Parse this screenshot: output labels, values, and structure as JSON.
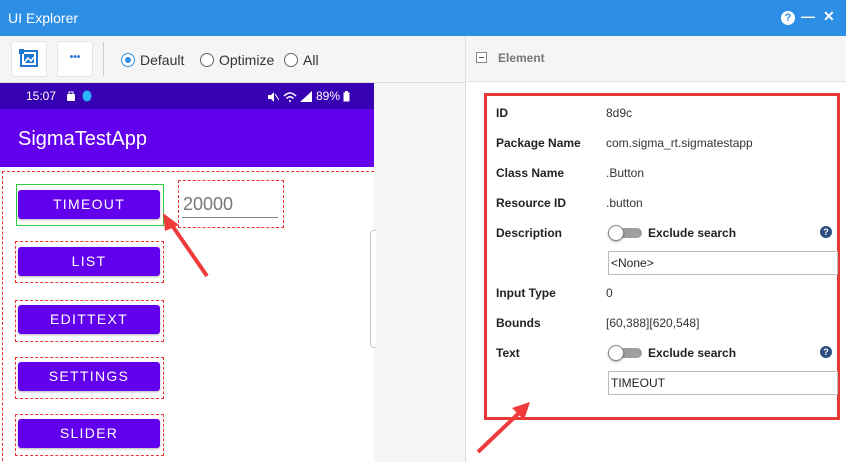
{
  "window": {
    "title": "UI Explorer",
    "help_glyph": "?",
    "minimize_glyph": "—",
    "close_glyph": "✕"
  },
  "toolbar": {
    "more_glyph": "•••",
    "modes": [
      {
        "label": "Default",
        "selected": true
      },
      {
        "label": "Optimize",
        "selected": false
      },
      {
        "label": "All",
        "selected": false
      }
    ]
  },
  "device": {
    "status_time": "15:07",
    "status_battery": "89%",
    "app_title": "SigmaTestApp",
    "buttons": [
      "TIMEOUT",
      "LIST",
      "EDITTEXT",
      "SETTINGS",
      "SLIDER"
    ],
    "edit_value": "20000"
  },
  "element_panel": {
    "header": "Element",
    "rows": [
      {
        "key": "ID",
        "value": "8d9c"
      },
      {
        "key": "Package Name",
        "value": "com.sigma_rt.sigmatestapp"
      },
      {
        "key": "Class Name",
        "value": ".Button"
      },
      {
        "key": "Resource ID",
        "value": ".button"
      },
      {
        "key": "Description",
        "toggle_label": "Exclude search",
        "field_value": "<None>"
      },
      {
        "key": "Input Type",
        "value": "0"
      },
      {
        "key": "Bounds",
        "value": "[60,388][620,548]"
      },
      {
        "key": "Text",
        "toggle_label": "Exclude search",
        "field_value": "TIMEOUT"
      }
    ],
    "help_glyph": "?"
  },
  "colors": {
    "title_bar": "#2d8ee6",
    "app_bar": "#6200ee",
    "status_bar": "#3700b3",
    "highlight": "#e53935"
  }
}
